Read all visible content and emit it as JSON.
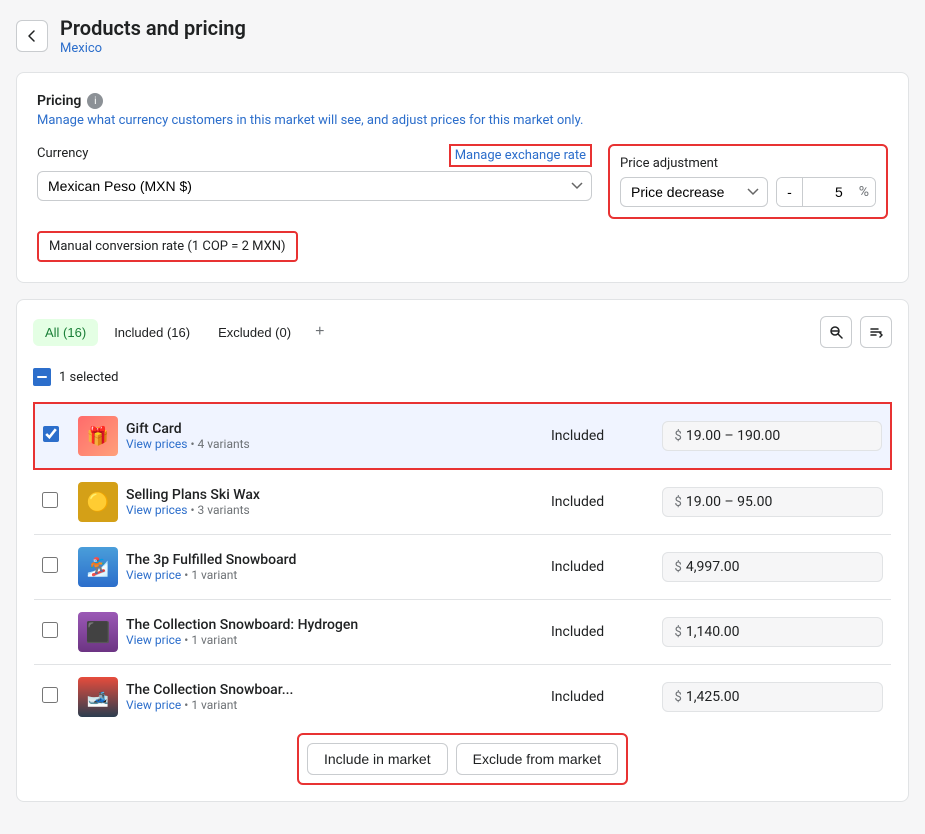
{
  "header": {
    "back_label": "←",
    "title": "Products and pricing",
    "subtitle": "Mexico"
  },
  "pricing_card": {
    "title": "Pricing",
    "description": "Manage what currency customers in this market will see, and adjust prices for this market only.",
    "currency_label": "Currency",
    "manage_exchange_label": "Manage exchange rate",
    "currency_value": "Mexican Peso (MXN $)",
    "manual_rate": "Manual conversion rate (1 COP = 2 MXN)",
    "price_adjustment_label": "Price adjustment",
    "price_decrease_label": "Price decrease",
    "price_decrease_value": "5",
    "price_decrease_symbol": "%",
    "price_minus": "-"
  },
  "tabs": [
    {
      "label": "All (16)",
      "active": true
    },
    {
      "label": "Included (16)",
      "active": false
    },
    {
      "label": "Excluded (0)",
      "active": false
    }
  ],
  "tab_add": "+",
  "selected_count": "1 selected",
  "products": [
    {
      "id": "gift-card",
      "name": "Gift Card",
      "meta_link": "View prices",
      "meta_extra": "4 variants",
      "status": "Included",
      "price": "$ 19.00 – 190.00",
      "selected": true,
      "img_type": "gift"
    },
    {
      "id": "ski-wax",
      "name": "Selling Plans Ski Wax",
      "meta_link": "View prices",
      "meta_extra": "3 variants",
      "status": "Included",
      "price": "$ 19.00 – 95.00",
      "selected": false,
      "img_type": "wax"
    },
    {
      "id": "snowboard-3p",
      "name": "The 3p Fulfilled Snowboard",
      "meta_link": "View price",
      "meta_extra": "1 variant",
      "status": "Included",
      "price": "$ 4,997.00",
      "selected": false,
      "img_type": "snowboard"
    },
    {
      "id": "hydrogen",
      "name": "The Collection Snowboard: Hydrogen",
      "meta_link": "View price",
      "meta_extra": "1 variant",
      "status": "Included",
      "price": "$ 1,140.00",
      "selected": false,
      "img_type": "hydrogen"
    },
    {
      "id": "collection-bottom",
      "name": "The Collection Snowboar...",
      "meta_link": "View price",
      "meta_extra": "1 variant",
      "status": "Included",
      "price": "$ 1,425.00",
      "selected": false,
      "img_type": "collection"
    }
  ],
  "action_buttons": {
    "include": "Include in market",
    "exclude": "Exclude from market"
  },
  "icons": {
    "search": "🔍",
    "filter": "≡",
    "sort": "↕"
  }
}
